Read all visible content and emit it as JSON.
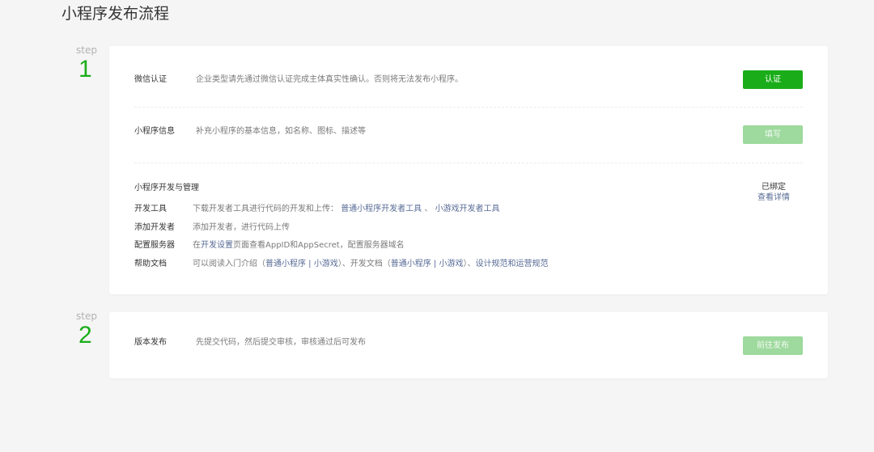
{
  "page": {
    "title": "小程序发布流程"
  },
  "steps": [
    {
      "label": "step",
      "number": "1"
    },
    {
      "label": "step",
      "number": "2"
    }
  ],
  "wechat_auth": {
    "label": "微信认证",
    "desc": "企业类型请先通过微信认证完成主体真实性确认。否则将无法发布小程序。",
    "button": "认证"
  },
  "mp_info": {
    "label": "小程序信息",
    "desc": "补充小程序的基本信息，如名称、图标、描述等",
    "button": "填写"
  },
  "dev_manage": {
    "title": "小程序开发与管理",
    "status": "已绑定",
    "detail_link": "查看详情",
    "dev_tools": {
      "label": "开发工具",
      "desc": "下载开发者工具进行代码的开发和上传：",
      "link1": "普通小程序开发者工具",
      "sep": "、",
      "link2": "小游戏开发者工具"
    },
    "add_dev": {
      "label": "添加开发者",
      "desc": "添加开发者，进行代码上传"
    },
    "server": {
      "label": "配置服务器",
      "pre": "在",
      "link": "开发设置",
      "post": "页面查看AppID和AppSecret，配置服务器域名"
    },
    "help": {
      "label": "帮助文档",
      "t1": "可以阅读入门介绍（",
      "l1": "普通小程序",
      "t2": " | ",
      "l2": "小游戏",
      "t3": "）、开发文档（",
      "l3": "普通小程序",
      "t4": " | ",
      "l4": "小游戏",
      "t5": "）、",
      "l5": "设计规范",
      "t6": "和",
      "l6": "运营规范"
    }
  },
  "publish": {
    "label": "版本发布",
    "desc": "先提交代码，然后提交审核，审核通过后可发布",
    "button": "前往发布"
  },
  "colors": {
    "primary": "#1aad19",
    "primary_disabled": "#9ed99d",
    "link": "#576b95",
    "background": "#f5f5f5"
  }
}
